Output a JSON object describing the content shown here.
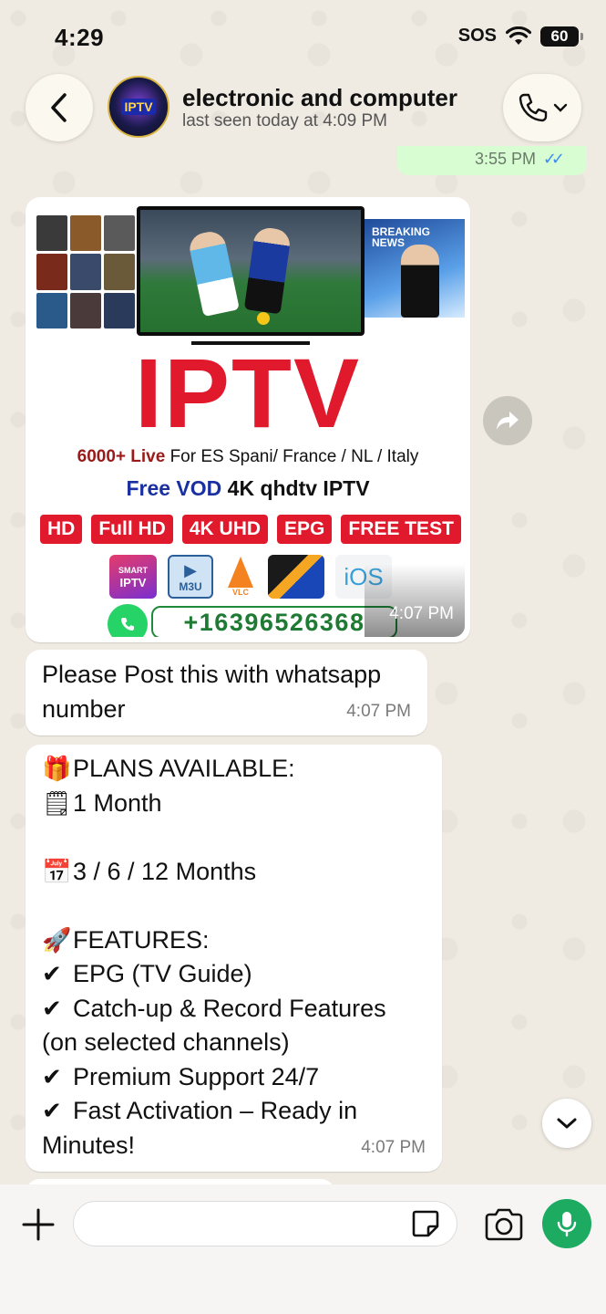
{
  "status_bar": {
    "time": "4:29",
    "sos": "SOS",
    "battery": "60"
  },
  "header": {
    "contact_name": "electronic and computer",
    "last_seen": "last seen today at 4:09 PM",
    "avatar_text": "IPTV"
  },
  "messages": {
    "partial_out": {
      "time": "3:55 PM",
      "ticks": "✓✓"
    },
    "image": {
      "news_label_1": "BREAKING",
      "news_label_2": "NEWS",
      "headline": "IPTV",
      "line1_bold": "6000+ Live",
      "line1_rest": "For ES Spani/ France / NL / Italy",
      "line2_blue": "Free VOD",
      "line2_rest": "4K qhdtv IPTV",
      "badges": [
        "HD",
        "Full HD",
        "4K UHD",
        "EPG",
        "FREE TEST"
      ],
      "logo_smart_1": "SMART",
      "logo_smart_2": "IPTV",
      "logo_m3u": "M3U",
      "logo_vlc": "VLC",
      "logo_ios": "iOS",
      "phone": "+16396526368",
      "time": "4:07 PM"
    },
    "please_post": {
      "line1": "Please Post this with whatsapp",
      "line2": "number",
      "time": "4:07 PM"
    },
    "plans": {
      "lines": [
        {
          "emoji": "🎁",
          "text": "PLANS AVAILABLE:"
        },
        {
          "emoji": "🗒",
          "text": "1 Month"
        },
        {
          "emoji": "",
          "text": ""
        },
        {
          "emoji": "📅",
          "text": "3 / 6 / 12 Months"
        },
        {
          "emoji": "",
          "text": ""
        },
        {
          "emoji": "🚀",
          "text": "FEATURES:"
        },
        {
          "emoji": "✔",
          "text": "EPG (TV Guide)"
        },
        {
          "emoji": "✔",
          "text": "Catch-up & Record Features"
        },
        {
          "emoji": "",
          "text": "(on selected channels)"
        },
        {
          "emoji": "✔",
          "text": "Premium Support 24/7"
        },
        {
          "emoji": "✔",
          "text": "Fast Activation – Ready in"
        },
        {
          "emoji": "",
          "text": "Minutes!"
        }
      ],
      "time": "4:07 PM"
    }
  },
  "composer": {
    "placeholder": ""
  },
  "colors": {
    "bubble_out": "#d9fdd3",
    "accent_green": "#1daa61",
    "iptv_red": "#e0192c",
    "whatsapp_green": "#25d366"
  },
  "icons": [
    "back-icon",
    "phone-icon",
    "chevron-down-icon",
    "forward-icon",
    "plus-icon",
    "sticker-icon",
    "camera-icon",
    "mic-icon",
    "wifi-icon",
    "whatsapp-icon"
  ]
}
